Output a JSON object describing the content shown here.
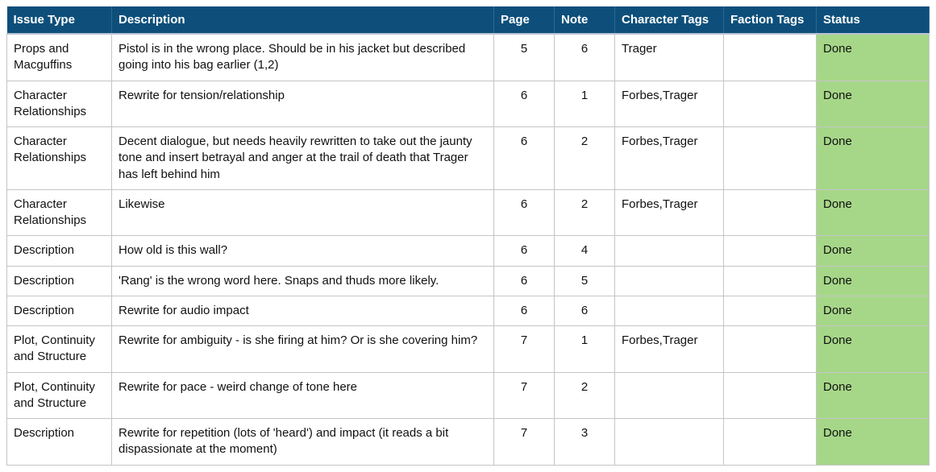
{
  "headers": {
    "issue_type": "Issue Type",
    "description": "Description",
    "page": "Page",
    "note": "Note",
    "character_tags": "Character Tags",
    "faction_tags": "Faction Tags",
    "status": "Status"
  },
  "status_done_bg": "#a6d788",
  "rows": [
    {
      "issue_type": "Props and Macguffins",
      "description": "Pistol is in the wrong place. Should be in his jacket but described going into his bag earlier (1,2)",
      "page": "5",
      "note": "6",
      "character_tags": "Trager",
      "faction_tags": "",
      "status": "Done"
    },
    {
      "issue_type": "Character Relationships",
      "description": "Rewrite for tension/relationship",
      "page": "6",
      "note": "1",
      "character_tags": "Forbes,Trager",
      "faction_tags": "",
      "status": "Done"
    },
    {
      "issue_type": "Character Relationships",
      "description": "Decent dialogue, but needs heavily rewritten to take out the jaunty tone and insert betrayal and anger at the trail of death that Trager has left behind him",
      "page": "6",
      "note": "2",
      "character_tags": "Forbes,Trager",
      "faction_tags": "",
      "status": "Done"
    },
    {
      "issue_type": "Character Relationships",
      "description": "Likewise",
      "page": "6",
      "note": "2",
      "character_tags": "Forbes,Trager",
      "faction_tags": "",
      "status": "Done"
    },
    {
      "issue_type": "Description",
      "description": "How old is this wall?",
      "page": "6",
      "note": "4",
      "character_tags": "",
      "faction_tags": "",
      "status": "Done"
    },
    {
      "issue_type": "Description",
      "description": "'Rang' is the wrong word here. Snaps and thuds more likely.",
      "page": "6",
      "note": "5",
      "character_tags": "",
      "faction_tags": "",
      "status": "Done"
    },
    {
      "issue_type": "Description",
      "description": "Rewrite for audio impact",
      "page": "6",
      "note": "6",
      "character_tags": "",
      "faction_tags": "",
      "status": "Done"
    },
    {
      "issue_type": "Plot, Continuity and Structure",
      "description": "Rewrite for ambiguity - is she firing at him? Or is she covering him?",
      "page": "7",
      "note": "1",
      "character_tags": "Forbes,Trager",
      "faction_tags": "",
      "status": "Done"
    },
    {
      "issue_type": "Plot, Continuity and Structure",
      "description": "Rewrite for pace - weird change of tone here",
      "page": "7",
      "note": "2",
      "character_tags": "",
      "faction_tags": "",
      "status": "Done"
    },
    {
      "issue_type": "Description",
      "description": "Rewrite for repetition (lots of 'heard') and impact (it reads a bit dispassionate at the moment)",
      "page": "7",
      "note": "3",
      "character_tags": "",
      "faction_tags": "",
      "status": "Done"
    }
  ]
}
